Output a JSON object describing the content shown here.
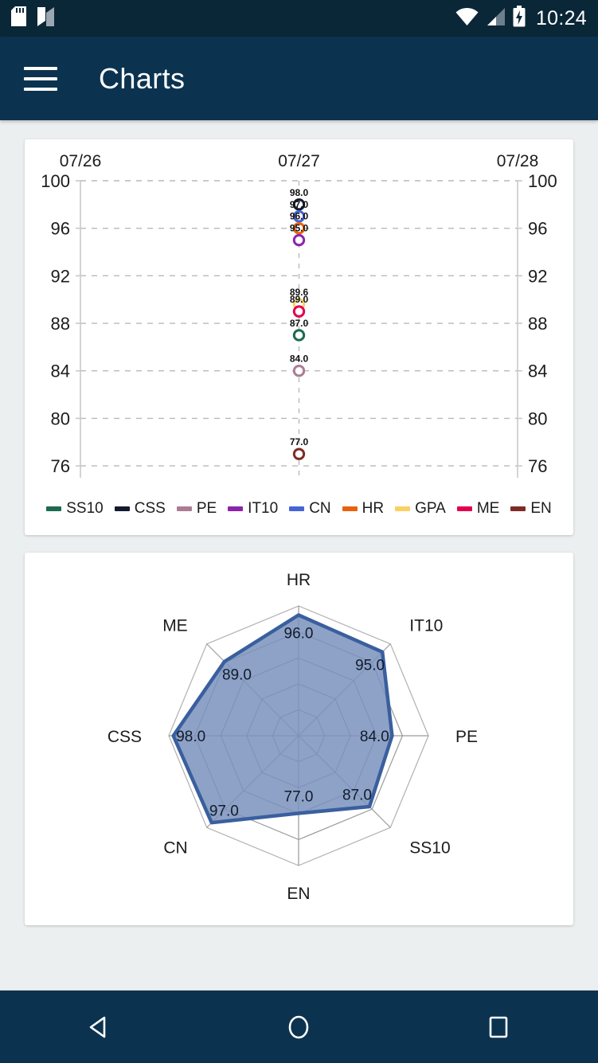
{
  "status_bar": {
    "time": "10:24",
    "icons": [
      "sd-card-icon",
      "nfc-n-icon",
      "wifi-icon",
      "cellular-signal-icon",
      "battery-charging-icon"
    ]
  },
  "app_bar": {
    "title": "Charts",
    "menu_icon": "hamburger-menu-icon"
  },
  "nav_bar": {
    "back": "back-triangle-icon",
    "home": "home-circle-icon",
    "recents": "recents-square-icon"
  },
  "theme": {
    "primary": "#0b3350",
    "status_bar": "#0a2738",
    "page_bg": "#eceff0",
    "card_bg": "#ffffff",
    "grid": "#b9b9b9",
    "axis_text": "#1c1c1c"
  },
  "series_colors": {
    "SS10": "#1a6b52",
    "CSS": "#121a2e",
    "PE": "#ab7d94",
    "IT10": "#8e23ab",
    "CN": "#4763d6",
    "HR": "#e8620f",
    "GPA": "#fbd062",
    "ME": "#e3004f",
    "EN": "#7f2b25"
  },
  "chart_data": [
    {
      "type": "scatter",
      "title": "",
      "xlabel": "",
      "ylabel": "",
      "x_tick_labels": [
        "07/26",
        "07/27",
        "07/28"
      ],
      "y_ticks": [
        76,
        80,
        84,
        88,
        92,
        96,
        100
      ],
      "ylim": [
        75,
        100
      ],
      "grid": true,
      "legend_position": "bottom",
      "legend": [
        "SS10",
        "CSS",
        "PE",
        "IT10",
        "CN",
        "HR",
        "GPA",
        "ME",
        "EN"
      ],
      "points": [
        {
          "series": "CSS",
          "x": "07/27",
          "y": 98.0,
          "label": "98.0",
          "color": "#121a2e"
        },
        {
          "series": "CN",
          "x": "07/27",
          "y": 97.0,
          "label": "97.0",
          "color": "#4763d6"
        },
        {
          "series": "HR",
          "x": "07/27",
          "y": 96.0,
          "label": "96.0",
          "color": "#e8620f"
        },
        {
          "series": "IT10",
          "x": "07/27",
          "y": 95.0,
          "label": "95.0",
          "color": "#8e23ab"
        },
        {
          "series": "GPA",
          "x": "07/27",
          "y": 89.6,
          "label": "89.6",
          "color": "#fbd062"
        },
        {
          "series": "ME",
          "x": "07/27",
          "y": 89.0,
          "label": "89.0",
          "color": "#e3004f"
        },
        {
          "series": "SS10",
          "x": "07/27",
          "y": 87.0,
          "label": "87.0",
          "color": "#1a6b52"
        },
        {
          "series": "PE",
          "x": "07/27",
          "y": 84.0,
          "label": "84.0",
          "color": "#ab7d94"
        },
        {
          "series": "EN",
          "x": "07/27",
          "y": 77.0,
          "label": "77.0",
          "color": "#7f2b25"
        }
      ]
    },
    {
      "type": "radar",
      "title": "",
      "categories": [
        "HR",
        "IT10",
        "PE",
        "SS10",
        "EN",
        "CN",
        "CSS",
        "ME"
      ],
      "values": [
        96.0,
        95.0,
        84.0,
        87.0,
        77.0,
        97.0,
        98.0,
        89.0
      ],
      "value_labels": [
        "96.0",
        "95.0",
        "84.0",
        "87.0",
        "77.0",
        "97.0",
        "98.0",
        "89.0"
      ],
      "rings": 5,
      "rmin": 0,
      "rmax": 100,
      "fill_color": "#7a92bd",
      "line_color": "#3a5f9e",
      "grid": true,
      "legend_position": "none"
    }
  ]
}
